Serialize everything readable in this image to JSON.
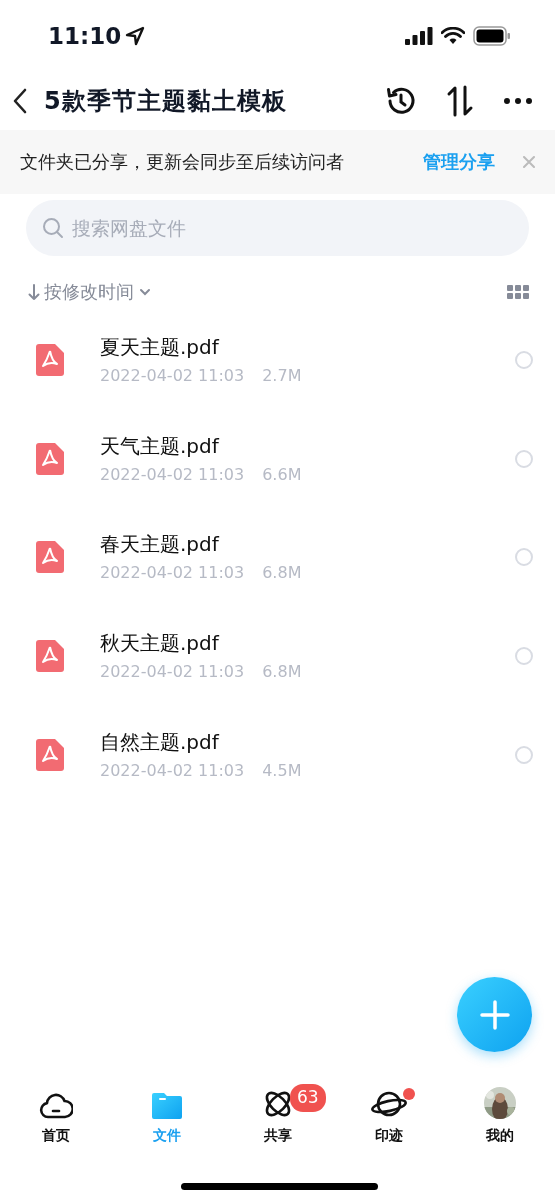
{
  "status_bar": {
    "time": "11:10"
  },
  "header": {
    "title": "5款季节主题黏土模板"
  },
  "banner": {
    "text": "文件夹已分享，更新会同步至后续访问者",
    "action": "管理分享"
  },
  "search": {
    "placeholder": "搜索网盘文件"
  },
  "sort": {
    "label": "按修改时间"
  },
  "files": [
    {
      "name": "夏天主题.pdf",
      "date": "2022-04-02 11:03",
      "size": "2.7M",
      "selected": false
    },
    {
      "name": "天气主题.pdf",
      "date": "2022-04-02 11:03",
      "size": "6.6M",
      "selected": false
    },
    {
      "name": "春天主题.pdf",
      "date": "2022-04-02 11:03",
      "size": "6.8M",
      "selected": false
    },
    {
      "name": "秋天主题.pdf",
      "date": "2022-04-02 11:03",
      "size": "6.8M",
      "selected": false
    },
    {
      "name": "自然主题.pdf",
      "date": "2022-04-02 11:03",
      "size": "4.5M",
      "selected": false
    }
  ],
  "tabs": [
    {
      "kind": "cloud",
      "label": "首页",
      "selected": false
    },
    {
      "kind": "folder",
      "label": "文件",
      "selected": true
    },
    {
      "kind": "atom",
      "label": "共享",
      "selected": false,
      "badge": "63"
    },
    {
      "kind": "planet",
      "label": "印迹",
      "selected": false,
      "dot": true
    },
    {
      "kind": "avatar",
      "label": "我的",
      "selected": false
    }
  ]
}
